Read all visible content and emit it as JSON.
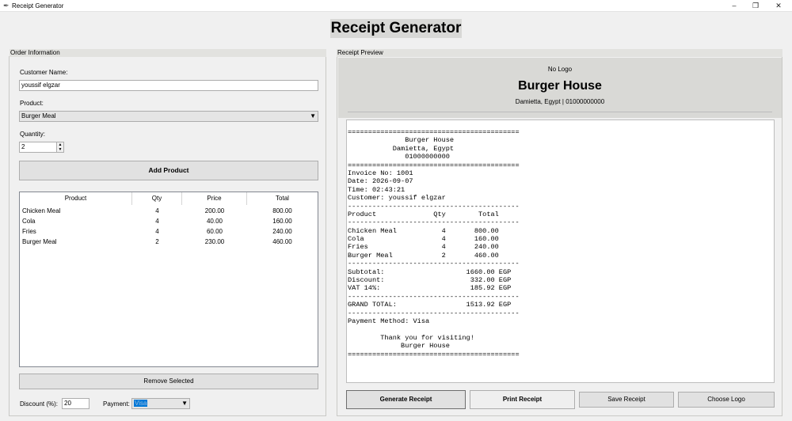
{
  "window": {
    "title": "Receipt Generator"
  },
  "heading": "Receipt Generator",
  "order": {
    "frame_label": "Order Information",
    "customer_label": "Customer Name:",
    "customer_value": "youssif elgzar",
    "product_label": "Product:",
    "product_value": "Burger Meal",
    "quantity_label": "Quantity:",
    "quantity_value": "2",
    "add_button": "Add Product",
    "table": {
      "headers": [
        "Product",
        "Qty",
        "Price",
        "Total"
      ],
      "rows": [
        [
          "Chicken Meal",
          "4",
          "200.00",
          "800.00"
        ],
        [
          "Cola",
          "4",
          "40.00",
          "160.00"
        ],
        [
          "Fries",
          "4",
          "60.00",
          "240.00"
        ],
        [
          "Burger Meal",
          "2",
          "230.00",
          "460.00"
        ]
      ]
    },
    "remove_button": "Remove Selected",
    "discount_label": "Discount (%):",
    "discount_value": "20",
    "payment_label": "Payment:",
    "payment_value": "Visa"
  },
  "preview": {
    "frame_label": "Receipt Preview",
    "logo_text": "No Logo",
    "shop_name": "Burger House",
    "shop_info": "Damietta, Egypt | 01000000000",
    "receipt_lines": [
      "==========================================",
      "              Burger House",
      "           Damietta, Egypt",
      "              01000000000",
      "==========================================",
      "Invoice No: 1001",
      "Date: 2026-09-07",
      "Time: 02:43:21",
      "Customer: youssif elgzar",
      "------------------------------------------",
      "Product              Qty        Total",
      "------------------------------------------",
      "Chicken Meal           4       800.00",
      "Cola                   4       160.00",
      "Fries                  4       240.00",
      "Burger Meal            2       460.00",
      "------------------------------------------",
      "Subtotal:                    1660.00 EGP",
      "Discount:                     332.00 EGP",
      "VAT 14%:                      185.92 EGP",
      "------------------------------------------",
      "GRAND TOTAL:                 1513.92 EGP",
      "------------------------------------------",
      "Payment Method: Visa",
      "",
      "        Thank you for visiting!",
      "             Burger House",
      "=========================================="
    ],
    "buttons": {
      "generate": "Generate Receipt",
      "print": "Print Receipt",
      "save": "Save Receipt",
      "logo": "Choose Logo"
    }
  }
}
